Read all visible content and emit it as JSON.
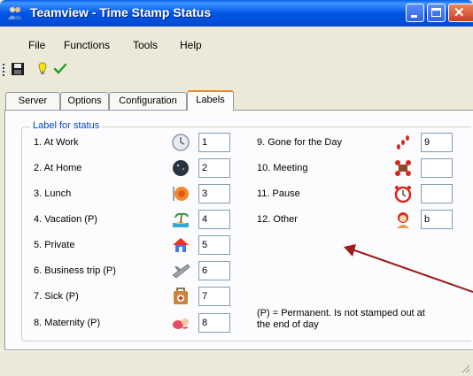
{
  "window": {
    "title": "Teamview - Time Stamp Status"
  },
  "menu": [
    "File",
    "Functions",
    "Tools",
    "Help"
  ],
  "toolbar": {
    "buttons": [
      "save-icon",
      "bulb-icon",
      "checkmark-icon"
    ]
  },
  "tabs": [
    {
      "label": "Server",
      "active": false
    },
    {
      "label": "Options",
      "active": false
    },
    {
      "label": "Configuration",
      "active": false
    },
    {
      "label": "Labels",
      "active": true
    }
  ],
  "group": {
    "legend": "Label for status",
    "left_rows": [
      {
        "label": "1. At Work",
        "icon": "clock-icon",
        "value": "1"
      },
      {
        "label": "2. At Home",
        "icon": "moon-icon",
        "value": "2"
      },
      {
        "label": "3. Lunch",
        "icon": "plate-icon",
        "value": "3"
      },
      {
        "label": "4. Vacation (P)",
        "icon": "island-icon",
        "value": "4"
      },
      {
        "label": "5. Private",
        "icon": "house-icon",
        "value": "5"
      },
      {
        "label": "6. Business trip  (P)",
        "icon": "plane-icon",
        "value": "6"
      },
      {
        "label": "7. Sick  (P)",
        "icon": "first-aid-icon",
        "value": "7"
      },
      {
        "label": "8. Maternity  (P)",
        "icon": "baby-icon",
        "value": "8"
      }
    ],
    "right_rows": [
      {
        "label": "9. Gone for the Day",
        "icon": "footprints-icon",
        "value": "9"
      },
      {
        "label": "10. Meeting",
        "icon": "meeting-icon",
        "value": ""
      },
      {
        "label": "11. Pause",
        "icon": "alarm-clock-icon",
        "value": ""
      },
      {
        "label": "12. Other",
        "icon": "person-icon",
        "value": "b"
      }
    ],
    "note": "(P) = Permanent. Is not stamped out at the end of day"
  },
  "colors": {
    "titlebar": "#0054E3",
    "legend": "#0046D5",
    "active_tab_accent": "#E68B2C",
    "annotation_arrow": "#A01818"
  }
}
